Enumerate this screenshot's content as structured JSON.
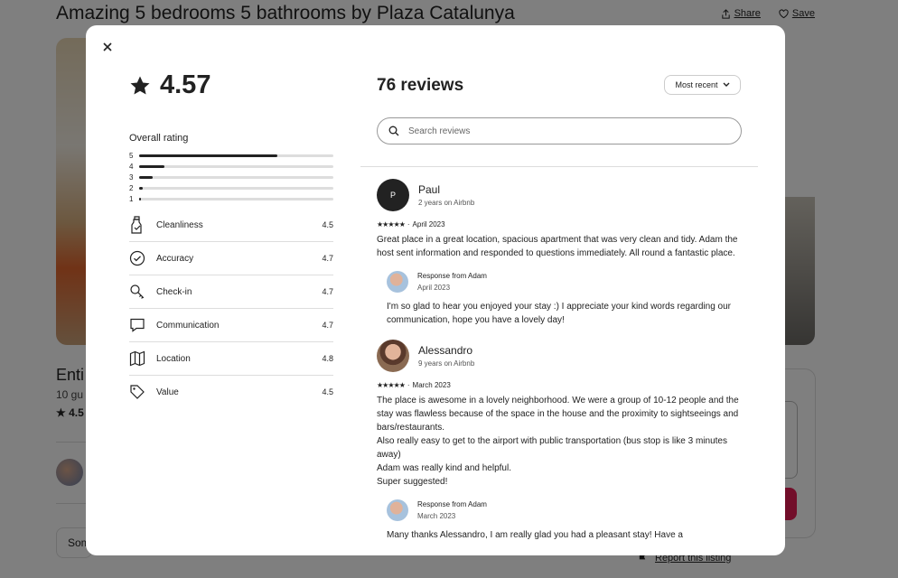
{
  "listing": {
    "title": "Amazing 5 bedrooms 5 bathrooms by Plaza Catalunya",
    "share_label": "Share",
    "save_label": "Save",
    "entire_partial": "Enti",
    "guests_partial": "10 gu",
    "rating_partial": "4.5",
    "some_partial": "Som",
    "report_label": "Report this listing"
  },
  "modal": {
    "overall_score": "4.57",
    "overall_label": "Overall rating",
    "distribution": [
      {
        "stars": "5",
        "fraction": 0.71
      },
      {
        "stars": "4",
        "fraction": 0.13
      },
      {
        "stars": "3",
        "fraction": 0.07
      },
      {
        "stars": "2",
        "fraction": 0.02
      },
      {
        "stars": "1",
        "fraction": 0.01
      }
    ],
    "categories": [
      {
        "name": "Cleanliness",
        "value": "4.5",
        "icon": "spray-bottle-icon"
      },
      {
        "name": "Accuracy",
        "value": "4.7",
        "icon": "check-circle-icon"
      },
      {
        "name": "Check-in",
        "value": "4.7",
        "icon": "key-icon"
      },
      {
        "name": "Communication",
        "value": "4.7",
        "icon": "message-icon"
      },
      {
        "name": "Location",
        "value": "4.8",
        "icon": "map-icon"
      },
      {
        "name": "Value",
        "value": "4.5",
        "icon": "tag-icon"
      }
    ],
    "reviews_count": "76 reviews",
    "sort_label": "Most recent",
    "search_placeholder": "Search reviews"
  },
  "reviews": [
    {
      "name": "Paul",
      "initial": "P",
      "tenure": "2 years on Airbnb",
      "stars": "★★★★★",
      "date": "April 2023",
      "text": "Great place in a great location, spacious apartment that was very clean and tidy. Adam the host sent information and responded to questions immediately. All round a fantastic place.",
      "response_title": "Response from Adam",
      "response_date": "April 2023",
      "response_text": "I'm so glad to hear you enjoyed your stay :) I appreciate your kind words regarding our communication, hope you have a lovely day!"
    },
    {
      "name": "Alessandro",
      "tenure": "9 years on Airbnb",
      "stars": "★★★★★",
      "date": "March 2023",
      "text": "The place is awesome in a lovely neighborhood. We were a group of 10-12 people and the stay was flawless because of the space in the house and the proximity to sightseeings and bars/restaurants.\nAlso really easy to get to the airport with public transportation (bus stop is like 3 minutes away)\nAdam was really kind and helpful.\nSuper suggested!",
      "response_title": "Response from Adam",
      "response_date": "March 2023",
      "response_text": "Many thanks Alessandro, I am really glad you had a pleasant stay! Have a"
    }
  ],
  "colors": {
    "accent": "#e51d55",
    "text": "#222222",
    "divider": "#dddddd"
  }
}
